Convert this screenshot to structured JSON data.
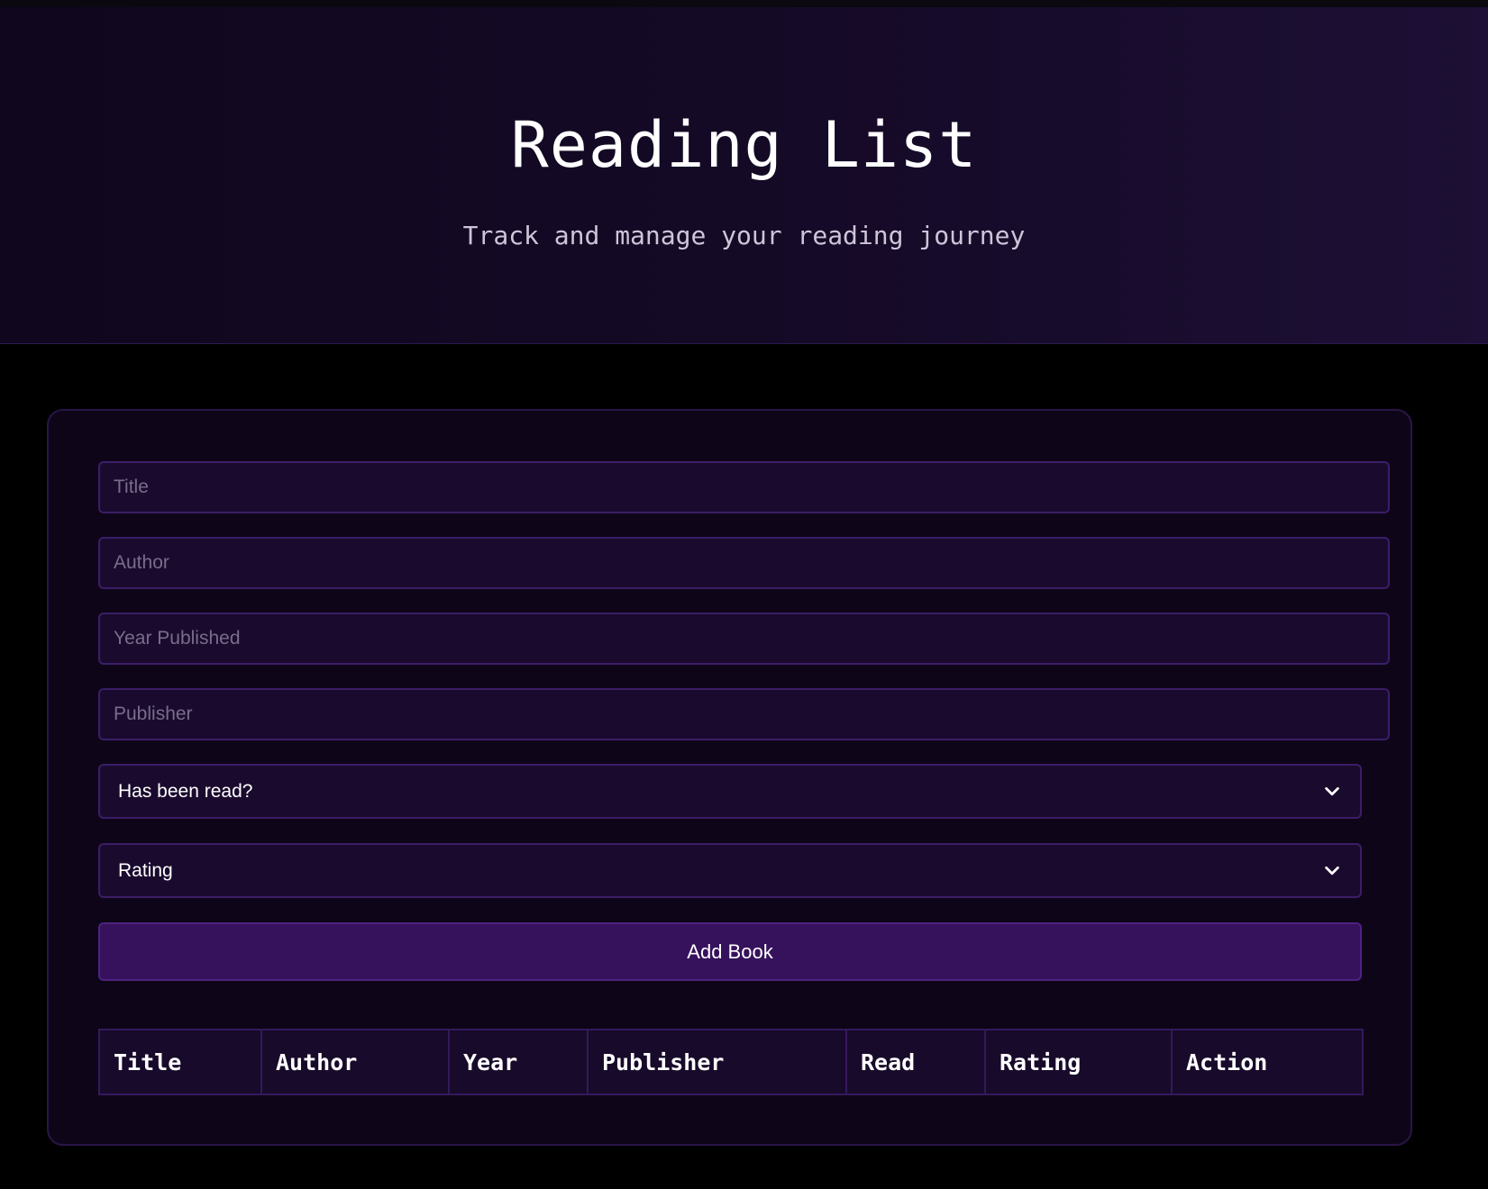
{
  "header": {
    "title": "Reading List",
    "subtitle": "Track and manage your reading journey"
  },
  "form": {
    "title_placeholder": "Title",
    "author_placeholder": "Author",
    "year_placeholder": "Year Published",
    "publisher_placeholder": "Publisher",
    "read_select_value": "Has been read?",
    "rating_select_value": "Rating",
    "add_button_label": "Add Book"
  },
  "table": {
    "columns": [
      "Title",
      "Author",
      "Year",
      "Publisher",
      "Read",
      "Rating",
      "Action"
    ],
    "rows": []
  },
  "colors": {
    "background": "#000000",
    "header_bg": "#150a27",
    "card_bg": "#0e0618",
    "field_bg": "#1a0b2e",
    "field_border": "#3b1d68",
    "accent": "#36125c"
  },
  "icons": {
    "select_arrow": "chevron-down-icon"
  }
}
